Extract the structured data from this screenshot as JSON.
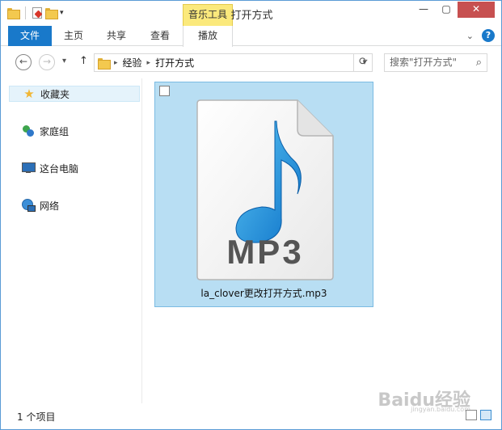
{
  "window": {
    "title": "打开方式",
    "context_tab_group": "音乐工具",
    "controls": {
      "minimize": "—",
      "maximize": "▢",
      "close": "✕"
    }
  },
  "ribbon": {
    "tabs": [
      {
        "label": "文件"
      },
      {
        "label": "主页"
      },
      {
        "label": "共享"
      },
      {
        "label": "查看"
      },
      {
        "label": "播放"
      }
    ],
    "help_icon": "?"
  },
  "address_bar": {
    "crumbs": [
      "经验",
      "打开方式"
    ],
    "search_placeholder": "搜索\"打开方式\""
  },
  "sidebar": {
    "items": [
      {
        "label": "收藏夹",
        "icon": "star-icon"
      },
      {
        "label": "家庭组",
        "icon": "homegroup-icon"
      },
      {
        "label": "这台电脑",
        "icon": "computer-icon"
      },
      {
        "label": "网络",
        "icon": "network-icon"
      }
    ]
  },
  "content": {
    "files": [
      {
        "name": "la_clover更改打开方式.mp3",
        "type_label": "MP3",
        "icon": "mp3-file-icon"
      }
    ]
  },
  "status_bar": {
    "item_count": "1 个项目"
  },
  "watermark": {
    "text": "Baidu经验",
    "sub": "jingyan.baidu.com"
  }
}
